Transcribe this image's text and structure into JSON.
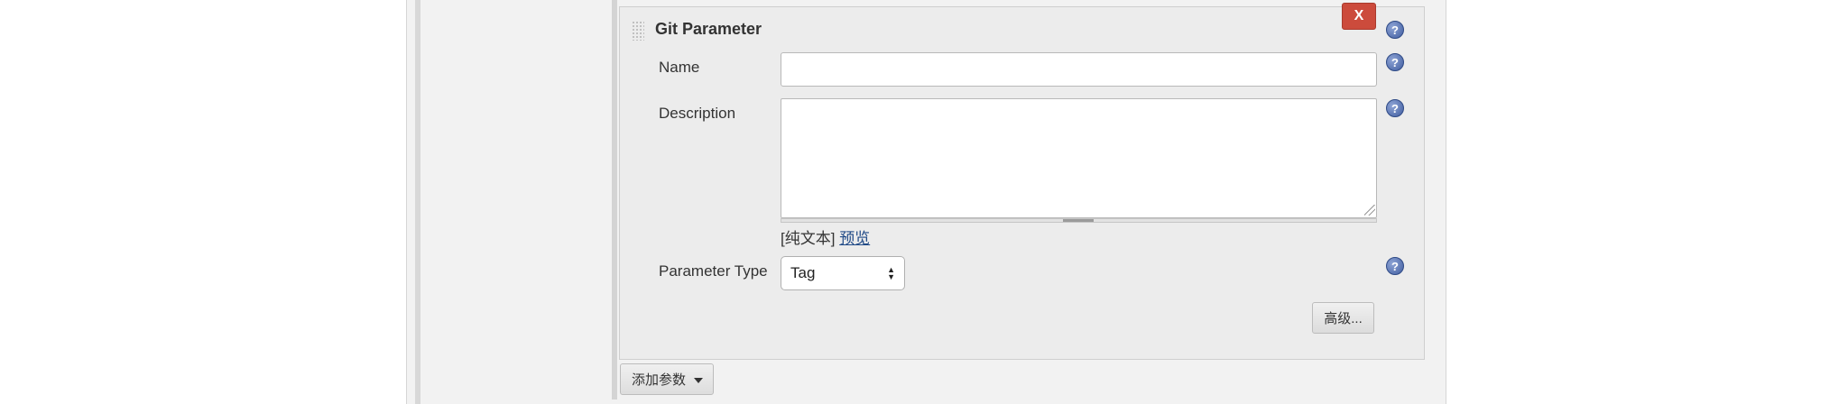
{
  "panel": {
    "title": "Git Parameter",
    "close_label": "X",
    "help_glyph": "?",
    "fields": {
      "name_label": "Name",
      "name_value": "",
      "description_label": "Description",
      "description_value": "",
      "format_plain": "[纯文本]",
      "format_preview": "预览",
      "parameter_type_label": "Parameter Type",
      "parameter_type_value": "Tag"
    },
    "advanced_label": "高级..."
  },
  "add_parameter_label": "添加参数",
  "colors": {
    "close_button": "#cc4b3c",
    "help_icon": "#3f5c9f",
    "link": "#204a87",
    "panel_bg": "#ececec"
  },
  "icons": [
    "drag-handle-icon",
    "close-icon",
    "help-icon",
    "chevron-down-icon",
    "resize-grip-icon"
  ]
}
